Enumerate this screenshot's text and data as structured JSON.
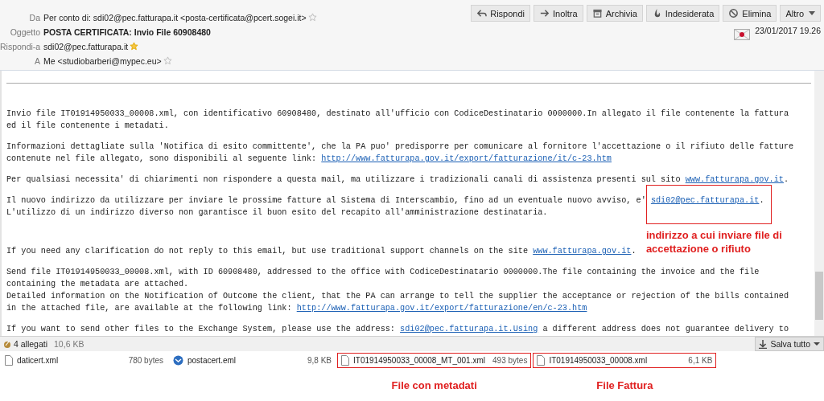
{
  "header": {
    "fields": [
      {
        "label": "Da",
        "value": "Per conto di: sdi02@pec.fatturapa.it <posta-certificata@pcert.sogei.it>",
        "kind": "address",
        "starred": false
      },
      {
        "label": "Oggetto",
        "value": "POSTA CERTIFICATA: Invio File 60908480",
        "kind": "subject"
      },
      {
        "label": "Rispondi-a",
        "value": "sdi02@pec.fatturapa.it",
        "kind": "address",
        "starred": true
      },
      {
        "label": "A",
        "value": "Me <studiobarberi@mypec.eu>",
        "kind": "address",
        "starred": false
      }
    ],
    "toolbar": [
      "Rispondi",
      "Inoltra",
      "Archivia",
      "Indesiderata",
      "Elimina",
      "Altro"
    ],
    "date": "23/01/2017 19.26"
  },
  "body": {
    "paragraphs": [
      {
        "lines": [
          [
            {
              "kind": "text",
              "text": "Invio file IT01914950033_00008.xml, con identificativo 60908480, destinato all'ufficio con CodiceDestinatario 0000000.In allegato il file contenente la fattura"
            }
          ],
          [
            {
              "kind": "text",
              "text": "ed il file contenente i metadati."
            }
          ]
        ]
      },
      {
        "lines": [
          [
            {
              "kind": "text",
              "text": "Informazioni dettagliate sulla 'Notifica di esito committente', che la PA puo' predisporre per comunicare al fornitore l'accettazione o il rifiuto delle fatture"
            }
          ],
          [
            {
              "kind": "text",
              "text": "contenute nel file allegato, sono disponibili al seguente link: "
            },
            {
              "kind": "link",
              "text": "http://www.fatturapa.gov.it/export/fatturazione/it/c-23.htm"
            }
          ]
        ]
      },
      {
        "lines": [
          [
            {
              "kind": "text",
              "text": "Per qualsiasi necessita' di chiarimenti non rispondere a questa mail, ma utilizzare i tradizionali canali di assistenza presenti sul sito "
            },
            {
              "kind": "link",
              "text": "www.fatturapa.gov.it"
            },
            {
              "kind": "text",
              "text": "."
            }
          ]
        ]
      },
      {
        "lines": [
          [
            {
              "kind": "text",
              "text": "Il nuovo indirizzo da utilizzare per inviare le prossime fatture al Sistema di Interscambio, fino ad un eventuale nuovo avviso, e' "
            },
            {
              "kind": "marked-link",
              "text": "sdi02@pec.fatturapa.it",
              "annotation": "indirizzo a cui inviare file di accettazione o rifiuto"
            },
            {
              "kind": "text",
              "text": "."
            }
          ],
          [
            {
              "kind": "text",
              "text": "L'utilizzo di un indirizzo diverso non garantisce il buon esito del recapito all'amministrazione destinataria."
            }
          ]
        ]
      },
      {
        "lines": [
          [
            {
              "kind": "text",
              "text": "If you need any clarification do not reply to this email, but use traditional support channels on the site "
            },
            {
              "kind": "link",
              "text": "www.fatturapa.gov.it"
            },
            {
              "kind": "text",
              "text": "."
            }
          ]
        ]
      },
      {
        "lines": [
          [
            {
              "kind": "text",
              "text": "Send file IT01914950033_00008.xml, with ID 60908480, addressed to the office with CodiceDestinatario 0000000.The file containing the invoice and the file"
            }
          ],
          [
            {
              "kind": "text",
              "text": "containing the metadata are attached."
            }
          ],
          [
            {
              "kind": "text",
              "text": "Detailed information on the Notification of Outcome the client, that the PA can arrange to tell the supplier the acceptance or rejection of the bills contained"
            }
          ],
          [
            {
              "kind": "text",
              "text": "in the attached file, are available at the following link: "
            },
            {
              "kind": "link",
              "text": "http://www.fatturapa.gov.it/export/fatturazione/en/c-23.htm"
            }
          ]
        ]
      },
      {
        "lines": [
          [
            {
              "kind": "text",
              "text": "If you want to send other files to the Exchange System, please use the address: "
            },
            {
              "kind": "link",
              "text": "sdi02@pec.fatturapa.it.Using"
            },
            {
              "kind": "text",
              "text": " a different address does not guarantee delivery to"
            }
          ]
        ]
      }
    ]
  },
  "attachments": {
    "count": "4 allegati",
    "size": "10,6 KB",
    "save_all": "Salva tutto",
    "items": [
      {
        "name": "daticert.xml",
        "size": "780 bytes",
        "kind": "file",
        "highlighted": false
      },
      {
        "name": "postacert.eml",
        "size": "9,8 KB",
        "kind": "mail",
        "highlighted": false
      },
      {
        "name": "IT01914950033_00008_MT_001.xml",
        "size": "493 bytes",
        "kind": "file",
        "highlighted": true,
        "annotation": "File con metadati"
      },
      {
        "name": "IT01914950033_00008.xml",
        "size": "6,1 KB",
        "kind": "file",
        "highlighted": true,
        "annotation": "File Fattura"
      }
    ]
  }
}
